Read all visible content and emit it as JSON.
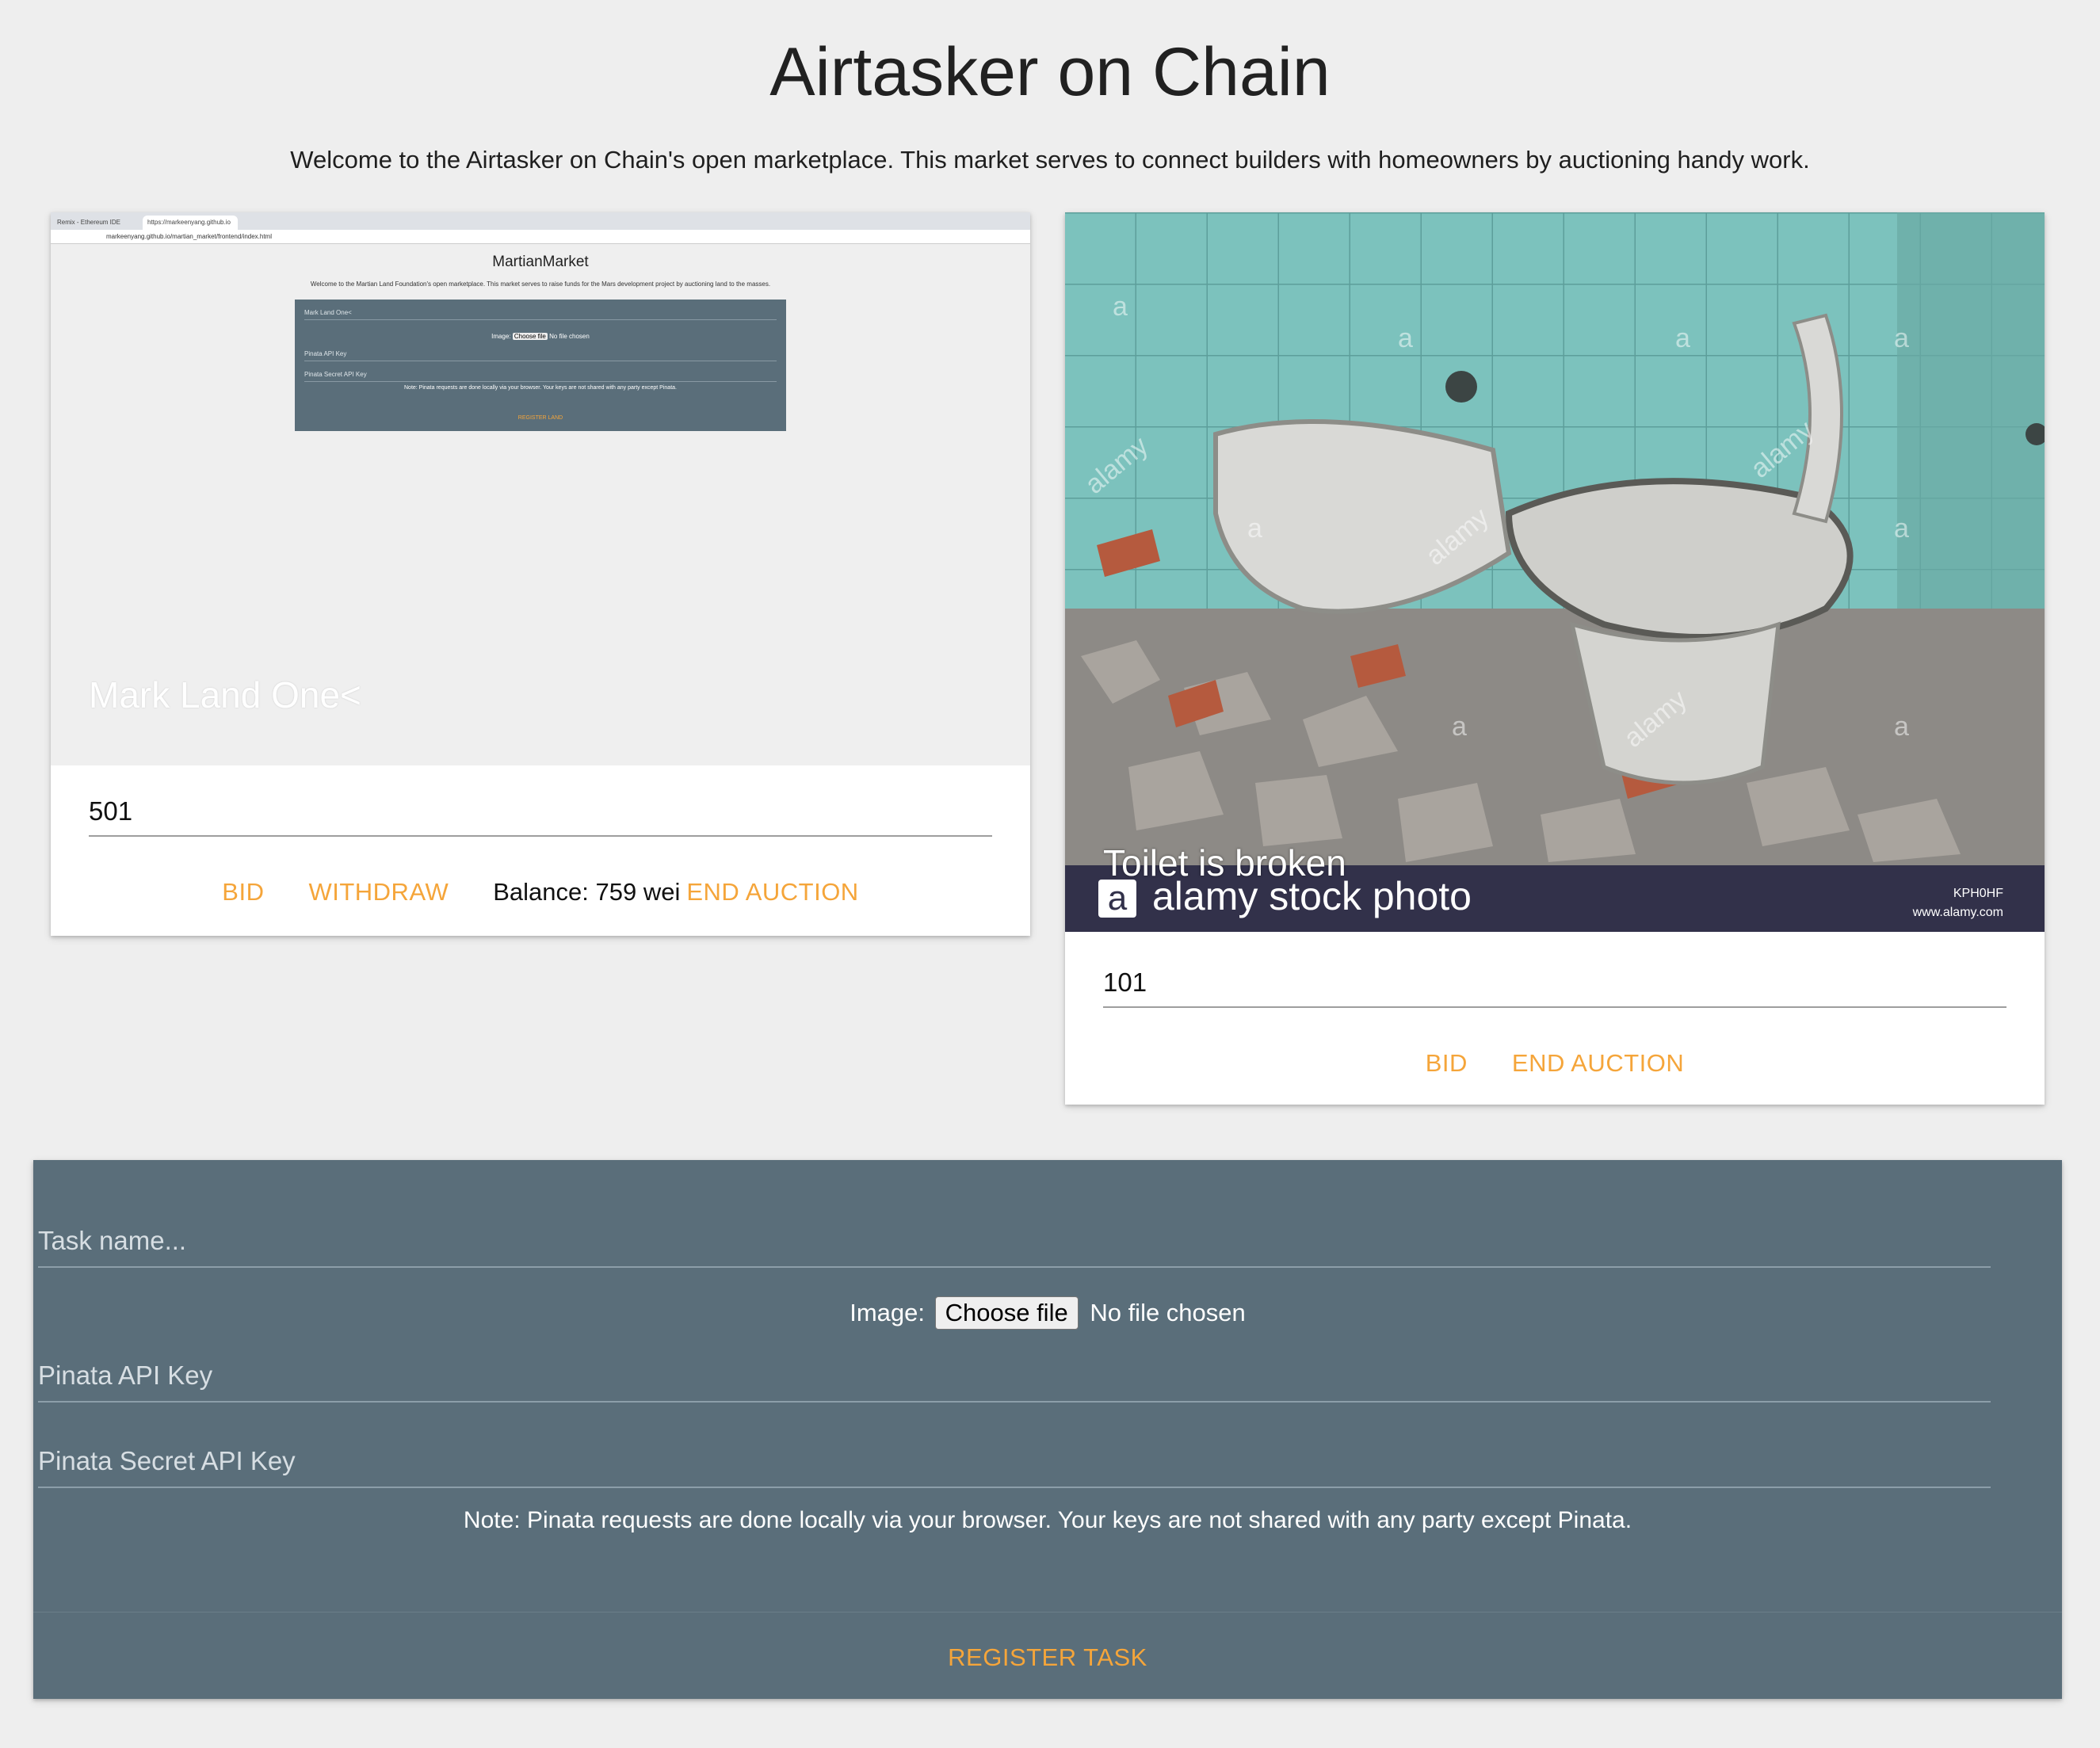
{
  "header": {
    "title": "Airtasker on Chain",
    "intro": "Welcome to the Airtasker on Chain's open marketplace. This market serves to connect builders with homeowners by auctioning handy work."
  },
  "cards": [
    {
      "image_title": "Mark Land One<",
      "bid_value": "501",
      "actions": {
        "bid": "BID",
        "withdraw": "WITHDRAW",
        "end_auction": "END AUCTION"
      },
      "balance": "Balance: 759 wei",
      "screenshot": {
        "tab1": "Remix - Ethereum IDE",
        "tab2": "https://markeenyang.github.io",
        "url": "markeenyang.github.io/martian_market/frontend/index.html",
        "title": "MartianMarket",
        "intro": "Welcome to the Martian Land Foundation's open marketplace. This market serves to raise funds for the Mars development project by auctioning land to the masses.",
        "field_name": "Mark Land One<",
        "image_label": "Image:",
        "choose_file": "Choose file",
        "no_file": "No file chosen",
        "api_key": "Pinata API Key",
        "secret_key": "Pinata Secret API Key",
        "note": "Note: Pinata requests are done locally via your browser. Your keys are not shared with any party except Pinata.",
        "register": "REGISTER LAND"
      }
    },
    {
      "image_title": "Toilet is broken",
      "bid_value": "101",
      "actions": {
        "bid": "BID",
        "end_auction": "END AUCTION"
      },
      "photo": {
        "brand": "alamy stock photo",
        "logo_letter": "a",
        "code": "KPH0HF",
        "site": "www.alamy.com",
        "watermark": "alamy",
        "watermark_letter": "a"
      }
    }
  ],
  "register_form": {
    "task_name_placeholder": "Task name...",
    "image_label": "Image:",
    "choose_file": "Choose file",
    "no_file": "No file chosen",
    "api_key_placeholder": "Pinata API Key",
    "secret_key_placeholder": "Pinata Secret API Key",
    "note": "Note: Pinata requests are done locally via your browser. Your keys are not shared with any party except Pinata.",
    "register_label": "REGISTER TASK"
  },
  "colors": {
    "accent": "#f5a53a",
    "form_bg": "#5a6e7a",
    "page_bg": "#eeeeee"
  }
}
